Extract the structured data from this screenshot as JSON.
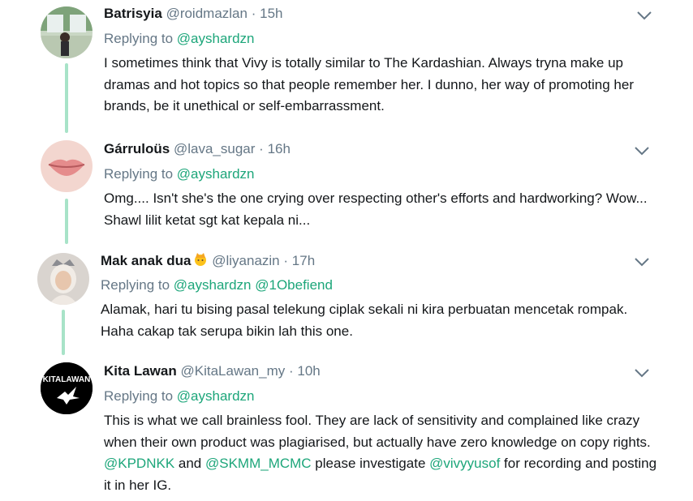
{
  "tweets": [
    {
      "name": "Batrisyia",
      "handle": "@roidmazlan",
      "time": "15h",
      "replying_label": "Replying to",
      "mentions": [
        "@ayshardzn"
      ],
      "text": "I sometimes think that Vivy is totally similar to The Kardashian. Always tryna make up dramas and hot topics so that people remember her. I dunno, her way of promoting her brands, be it unethical or self-embarrassment."
    },
    {
      "name": "Gárruloüs",
      "handle": "@lava_sugar",
      "time": "16h",
      "replying_label": "Replying to",
      "mentions": [
        "@ayshardzn"
      ],
      "text": "Omg.... Isn't she's the one crying over respecting other's efforts and hardworking? Wow... Shawl lilit ketat sgt kat kepala ni..."
    },
    {
      "name": "Mak anak dua",
      "name_emoji": "person-with-crown-emoji",
      "handle": "@liyanazin",
      "time": "17h",
      "replying_label": "Replying to",
      "mentions": [
        "@ayshardzn",
        "@1Obefiend"
      ],
      "text": "Alamak, hari tu bising pasal telekung ciplak sekali ni kira perbuatan mencetak rompak. Haha cakap tak serupa bikin lah this one."
    },
    {
      "name": "Kita Lawan",
      "handle": "@KitaLawan_my",
      "time": "10h",
      "replying_label": "Replying to",
      "mentions": [
        "@ayshardzn"
      ],
      "avatar_text": "KITALAWAN",
      "text_parts": [
        {
          "t": "This is what we call brainless fool. They are lack of sensitivity and complained like crazy when their own product was plagiarised, but actually have zero knowledge on copy rights. "
        },
        {
          "t": "@KPDNKK",
          "m": true
        },
        {
          "t": " and "
        },
        {
          "t": "@SKMM_MCMC",
          "m": true
        },
        {
          "t": " please investigate "
        },
        {
          "t": "@vivyyusof",
          "m": true
        },
        {
          "t": " for recording and posting it in her IG."
        }
      ]
    }
  ],
  "colors": {
    "link": "#1da67a",
    "thread_line": "#a8e3c8",
    "muted": "#657786"
  },
  "icons": {
    "caret": "chevron-down-icon"
  },
  "separator": "·"
}
